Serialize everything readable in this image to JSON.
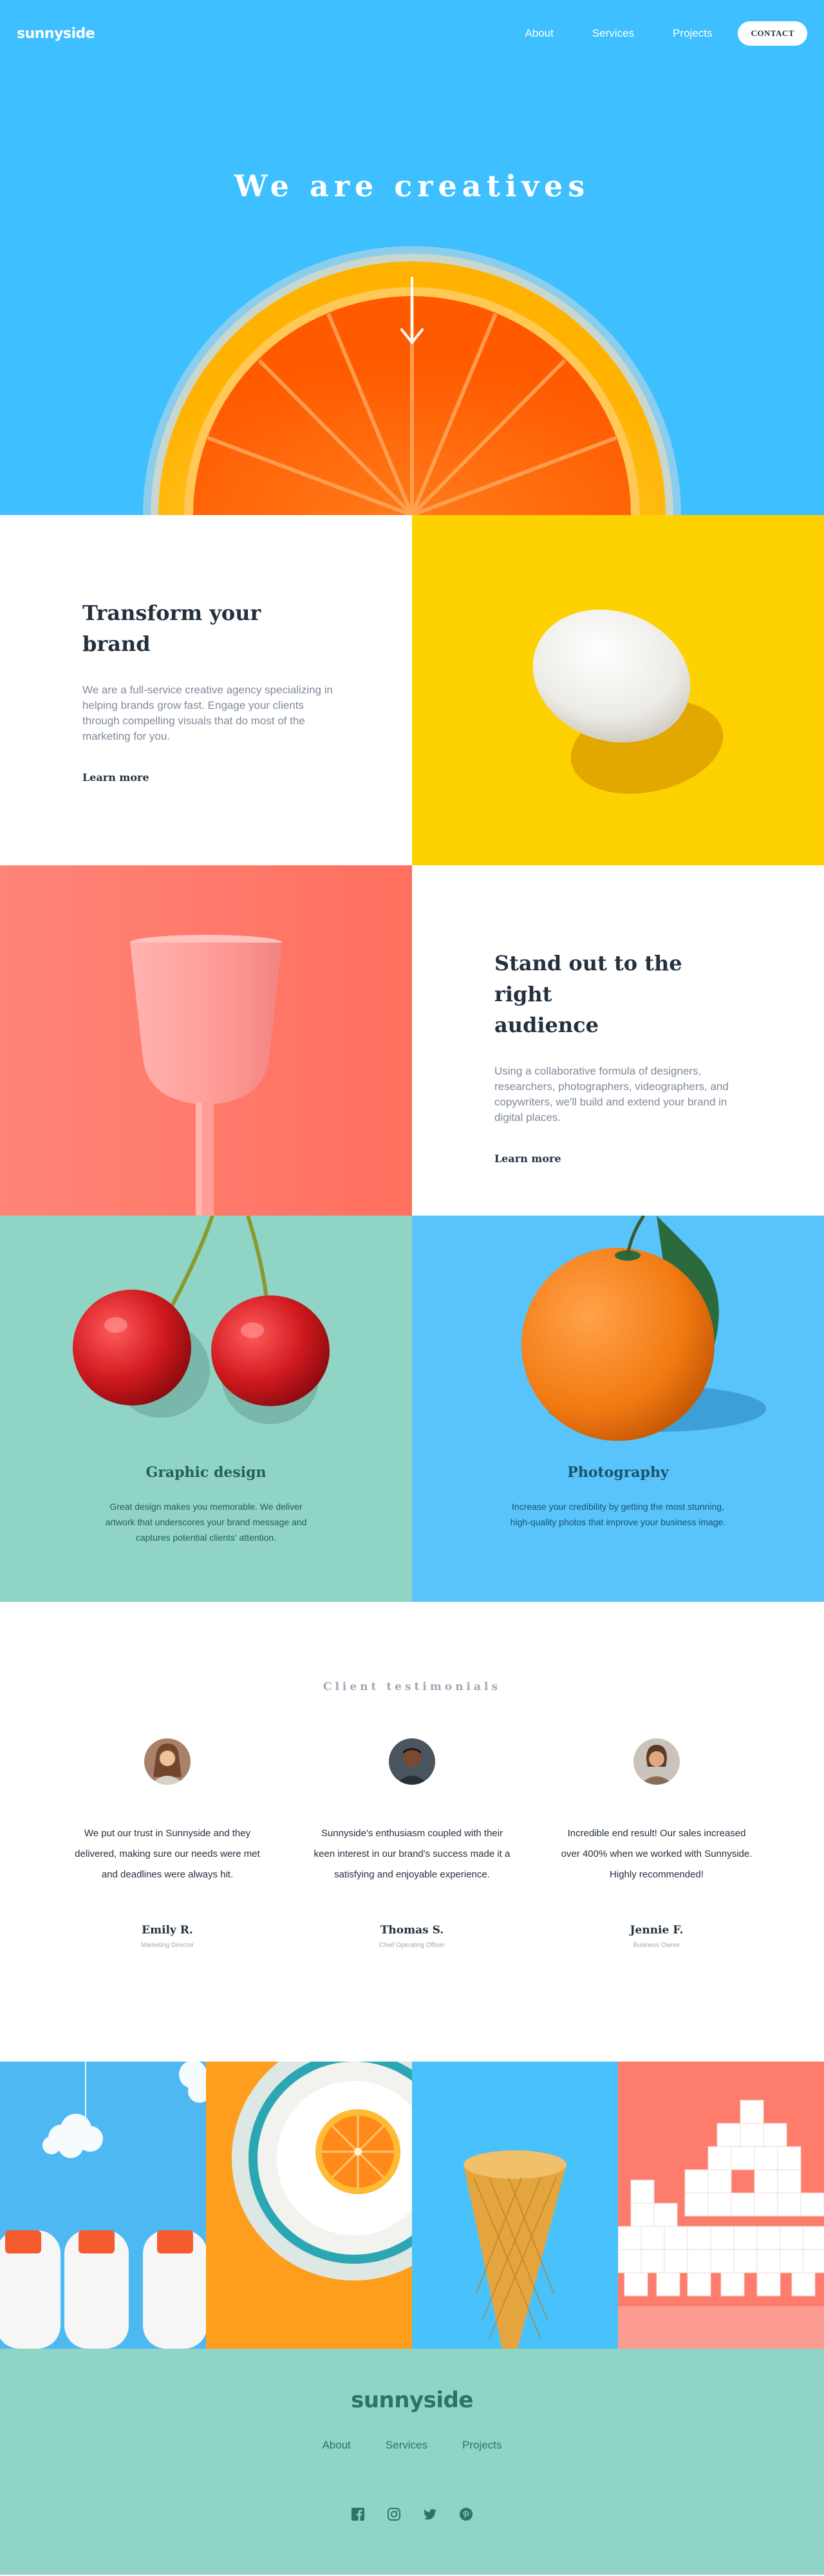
{
  "brand": {
    "logo": "sunnyside"
  },
  "nav": {
    "links": [
      "About",
      "Services",
      "Projects"
    ],
    "contact": "CONTACT"
  },
  "hero": {
    "title": "We are creatives"
  },
  "features": [
    {
      "title_line1": "Transform your",
      "title_line2": "brand",
      "body": "We are a full-service creative agency specializing in helping brands grow fast. Engage your clients through compelling visuals that do most of the marketing for you.",
      "link": "Learn more",
      "underline_color": "#fad400"
    },
    {
      "title_line1": "Stand out to the right",
      "title_line2": "audience",
      "body": "Using a collaborative formula of designers, researchers, photographers, videographers, and copywriters, we'll build and extend your brand in digital places.",
      "link": "Learn more",
      "underline_color": "#fe7865"
    }
  ],
  "services": [
    {
      "title": "Graphic design",
      "body": "Great design makes you memorable. We deliver artwork that underscores your brand message and captures potential clients' attention.",
      "bg": "#90d4c5",
      "text_color": "#24604f"
    },
    {
      "title": "Photography",
      "body": "Increase your credibility by getting the most stunning, high-quality photos that improve your business image.",
      "bg": "#59c4fb",
      "text_color": "#19536e"
    }
  ],
  "testimonials": {
    "heading": "Client testimonials",
    "items": [
      {
        "quote": "We put our trust in Sunnyside and they delivered, making sure our needs were met and deadlines were always hit.",
        "name": "Emily R.",
        "role": "Marketing Director"
      },
      {
        "quote": "Sunnyside's enthusiasm coupled with their keen interest in our brand's success made it a satisfying and enjoyable experience.",
        "name": "Thomas S.",
        "role": "Chief Operating Officer"
      },
      {
        "quote": "Incredible end result! Our sales increased over 400% when we worked with Sunnyside. Highly recommended!",
        "name": "Jennie F.",
        "role": "Business Owner"
      }
    ]
  },
  "footer": {
    "logo": "sunnyside",
    "links": [
      "About",
      "Services",
      "Projects"
    ],
    "social_icons": [
      "facebook-icon",
      "instagram-icon",
      "twitter-icon",
      "pinterest-icon"
    ]
  },
  "colors": {
    "hero_bg": "#3ebfff",
    "yellow": "#fed200",
    "coral": "#fe7865",
    "mint": "#90d4c5",
    "dark": "#23303e",
    "footer_text": "#2c7566"
  }
}
